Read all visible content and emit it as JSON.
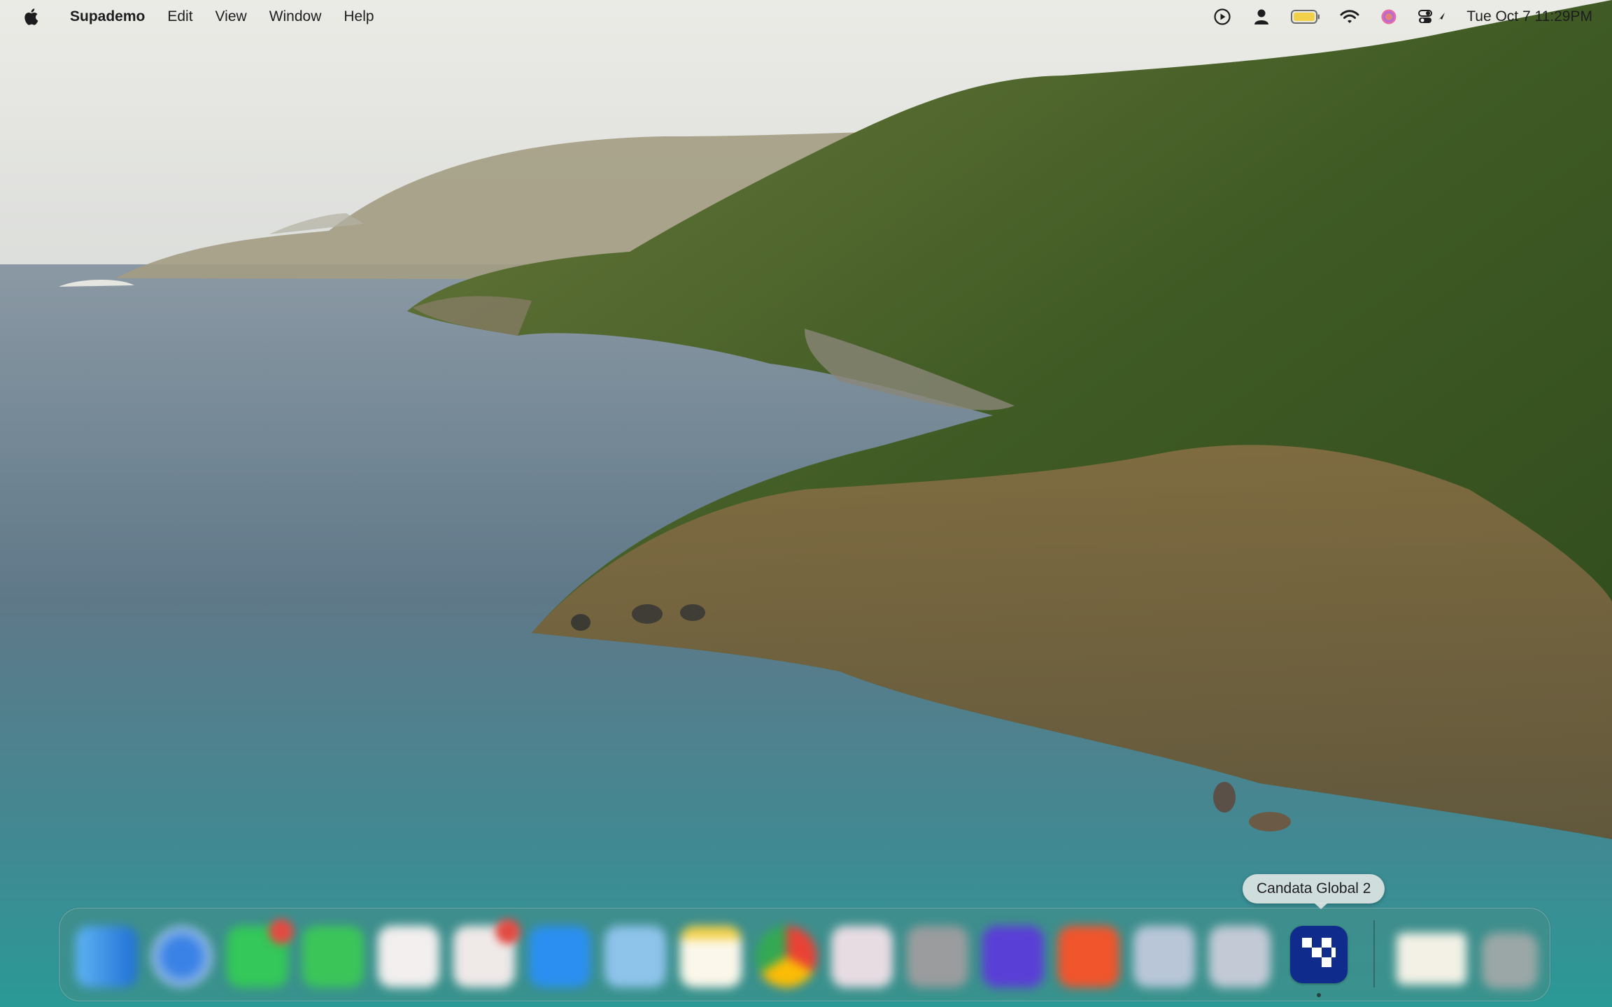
{
  "menubar": {
    "apple_icon": "apple-logo-icon",
    "app_name": "Supademo",
    "items": [
      "Edit",
      "View",
      "Window",
      "Help"
    ],
    "status_icons": [
      "play-circle-icon",
      "person-icon",
      "battery-icon",
      "wifi-icon",
      "siri-icon",
      "control-center-icon"
    ],
    "clock": "Tue Oct 7  11:29PM"
  },
  "dock": {
    "tooltip": "Candata Global 2",
    "active_app_icon": "candata-global-icon",
    "apps": [
      "finder",
      "safari",
      "messages",
      "facetime",
      "calendar",
      "reminders",
      "app-store",
      "telegram",
      "notes",
      "chrome",
      "photos",
      "system-settings",
      "arc",
      "brave",
      "utility",
      "utility-2",
      "candata-global-2"
    ],
    "active_color": "#0f2b8c"
  }
}
